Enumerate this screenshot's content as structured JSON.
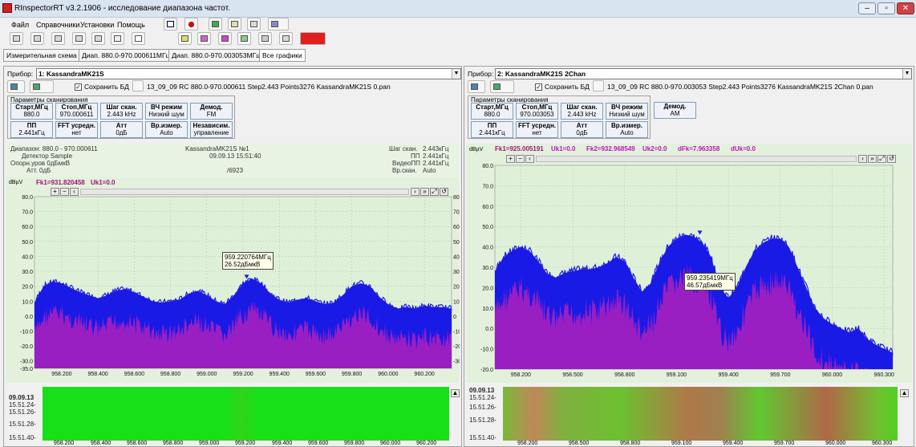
{
  "window": {
    "title": "RInspectorRT v3.2.1906 - исследование диапазона частот."
  },
  "menu": [
    "Файл",
    "Справочники",
    "Установки",
    "Помощь"
  ],
  "tabs": [
    "Измерительная схема",
    "Диап. 880.0-970.000611МГц",
    "Диап. 880.0-970.003053МГц",
    "Все графики"
  ],
  "left": {
    "device_label": "Прибор:",
    "device": "1: KassandraMK21S",
    "save_label": "Сохранить БД",
    "save_checked": "✓",
    "file": "13_09_09 RC 880.0-970.000611 Step2.443 Points3276 KassandraMK21S 0.pan",
    "params_title": "Параметры сканирования",
    "params": [
      {
        "title": "Старт,МГц",
        "value": "880.0"
      },
      {
        "title": "Стоп,МГц",
        "value": "970.000611"
      },
      {
        "title": "Шаг скан.",
        "value": "2.443 kHz"
      },
      {
        "title": "ВЧ режим",
        "value": "Низкий шум"
      },
      {
        "title": "Демод.",
        "value": "FM"
      },
      {
        "title": "ПП",
        "value": "2.441кГц"
      },
      {
        "title": "FFT усредн.",
        "value": "нет"
      },
      {
        "title": "Атт",
        "value": "0дБ"
      },
      {
        "title": "Вр.измер.",
        "value": "Auto"
      },
      {
        "title": "Независим.",
        "value": "управление"
      }
    ],
    "info": {
      "range": "Диапазон: 880.0 - 970.000611",
      "detector": "Детектор Sample",
      "ref_level": "Опорн.уров 0дБмкВ",
      "att": "Атт. 0дБ",
      "device_name": "KassandraMK21S №1",
      "datetime": "09.09.13 15:51:40",
      "points": "/6923",
      "step_label": "Шаг скан.",
      "step_value": "2.443кГц",
      "pp_label": "ПП",
      "pp_value": "2.441кГц",
      "vpp_label": "ВидеоПП",
      "vpp_value": "2.441кГц",
      "sweep_label": "Вр.скан.",
      "sweep_value": "Auto"
    },
    "unit": "dBµV",
    "markers": {
      "fk1": "Fk1=931.820458",
      "uk1": "Uk1=0.0"
    },
    "yticks": [
      "80.0",
      "70.0",
      "60.0",
      "50.0",
      "40.0",
      "30.0",
      "20.0",
      "10.0",
      "0.0",
      "-10.0",
      "-20.0",
      "-30.0",
      "-35.0"
    ],
    "yticks_right": [
      "80",
      "70",
      "60",
      "50",
      "40",
      "30",
      "20",
      "10",
      "0",
      "-10",
      "-20",
      "-30"
    ],
    "xticks": [
      "958.200",
      "958.400",
      "958.600",
      "958.800",
      "959.000",
      "959.200",
      "959.400",
      "959.600",
      "959.800",
      "960.000",
      "960.200"
    ],
    "tooltip": {
      "freq": "959.220764МГц",
      "level": "26.52дБмкВ"
    },
    "wf_times": [
      "09.09.13",
      "15.51.24-",
      "15.51.26-",
      "15.51.28-",
      "15.51.40-"
    ]
  },
  "right": {
    "device_label": "Прибор:",
    "device": "2: KassandraMK21S 2Chan",
    "save_label": "Сохранить БД",
    "save_checked": "✓",
    "file": "13_09_09 RC 880.0-970.003053 Step2.443 Points3276 KassandraMK21S 2Chan 0.pan",
    "params_title": "Параметры сканирования",
    "params": [
      {
        "title": "Старт,МГц",
        "value": "880.0"
      },
      {
        "title": "Стоп,МГц",
        "value": "970.003053"
      },
      {
        "title": "Шаг скан.",
        "value": "2.443 kHz"
      },
      {
        "title": "ВЧ режим",
        "value": "Низкий шум"
      },
      {
        "title": "Демод.",
        "value": "AM"
      },
      {
        "title": "ПП",
        "value": "2.441кГц"
      },
      {
        "title": "FFT усредн.",
        "value": "нет"
      },
      {
        "title": "Атт",
        "value": "0дБ"
      },
      {
        "title": "Вр.измер.",
        "value": "Auto"
      }
    ],
    "unit": "dBµV",
    "markers": {
      "fk1": "Fk1=925.005191",
      "uk1": "Uk1=0.0",
      "fk2": "Fk2=932.968549",
      "uk2": "Uk2=0.0",
      "dfk": "dFk=7.963358",
      "duk": "dUk=0.0"
    },
    "yticks": [
      "80.0",
      "70.0",
      "60.0",
      "50.0",
      "40.0",
      "30.0",
      "20.0",
      "10.0",
      "0.0",
      "-10.0",
      "-20.0"
    ],
    "xticks": [
      "958.200",
      "958.500",
      "958.800",
      "959.100",
      "959.400",
      "959.700",
      "960.000",
      "960.300"
    ],
    "tooltip": {
      "freq": "959.235419МГц",
      "level": "46.57дБмкВ"
    },
    "wf_times": [
      "09.09.13",
      "15.51.24-",
      "15.51.26-",
      "15.51.28-",
      "15.51.40-"
    ]
  },
  "colors": {
    "signal": "#1a1ae6",
    "fill": "#a020c0",
    "bg": "#e3f1dc",
    "waterfall": "#18e018",
    "marker": "#a0117a"
  },
  "chart_data": [
    {
      "type": "area",
      "ylim": [
        -35,
        80
      ],
      "xlim": [
        958.05,
        960.35
      ],
      "x": [
        958.05,
        958.1,
        958.15,
        958.2,
        958.25,
        958.3,
        958.35,
        958.4,
        958.45,
        958.5,
        958.55,
        958.6,
        958.65,
        958.7,
        958.75,
        958.8,
        958.85,
        958.9,
        958.95,
        959.0,
        959.05,
        959.1,
        959.15,
        959.2,
        959.25,
        959.3,
        959.35,
        959.4,
        959.45,
        959.5,
        959.55,
        959.6,
        959.65,
        959.7,
        959.75,
        959.8,
        959.85,
        959.9,
        959.95,
        960.0,
        960.05,
        960.1,
        960.15,
        960.2,
        960.25,
        960.3,
        960.35
      ],
      "y": [
        9,
        20,
        23,
        22,
        19,
        16,
        14,
        12,
        14,
        17,
        18,
        16,
        13,
        10,
        9,
        10,
        11,
        15,
        17,
        14,
        10,
        8,
        14,
        22,
        25,
        22,
        15,
        11,
        9,
        11,
        12,
        10,
        8,
        9,
        14,
        20,
        22,
        20,
        13,
        8,
        5,
        6,
        5,
        7,
        6,
        6,
        5
      ]
    },
    {
      "type": "area",
      "ylim": [
        -20,
        80
      ],
      "xlim": [
        958.05,
        960.35
      ],
      "x": [
        958.05,
        958.1,
        958.15,
        958.2,
        958.25,
        958.3,
        958.35,
        958.4,
        958.45,
        958.5,
        958.55,
        958.6,
        958.65,
        958.7,
        958.75,
        958.8,
        958.85,
        958.9,
        958.95,
        959.0,
        959.05,
        959.1,
        959.15,
        959.2,
        959.25,
        959.3,
        959.35,
        959.4,
        959.45,
        959.5,
        959.55,
        959.6,
        959.65,
        959.7,
        959.75,
        959.8,
        959.85,
        959.9,
        959.95,
        960.0,
        960.05,
        960.1,
        960.15,
        960.2,
        960.25,
        960.3,
        960.35
      ],
      "y": [
        28,
        35,
        38,
        40,
        38,
        33,
        27,
        25,
        27,
        28,
        29,
        29,
        30,
        32,
        35,
        33,
        25,
        18,
        22,
        32,
        40,
        44,
        46,
        45,
        42,
        35,
        20,
        15,
        20,
        30,
        38,
        42,
        44,
        44,
        40,
        30,
        20,
        10,
        5,
        2,
        0,
        -2,
        0,
        -5,
        -8,
        -10,
        -12
      ]
    }
  ]
}
